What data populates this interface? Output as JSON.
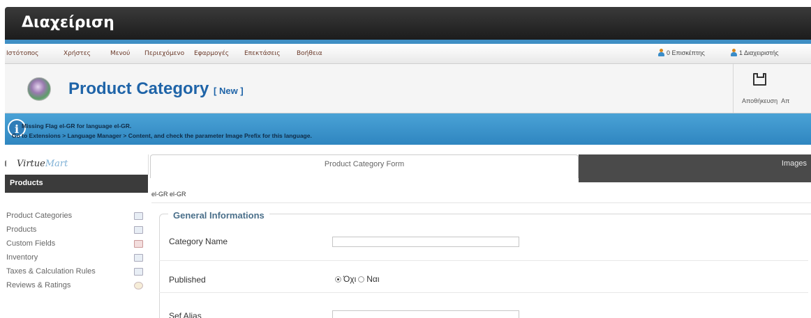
{
  "header": {
    "title": "Διαχείριση"
  },
  "menu": {
    "items": [
      "Ιστότοπος",
      "Χρήστες",
      "Μενού",
      "Περιεχόμενο",
      "Εφαρμογές",
      "Επεκτάσεις",
      "Βοήθεια"
    ]
  },
  "status": {
    "visitors": "0 Επισκέπτης",
    "admins": "1 Διαχειριστής"
  },
  "title": {
    "main": "Product Category",
    "tag": "[ New ]"
  },
  "toolbar": {
    "save_label": "Αποθήκευση",
    "next_label": "Απ"
  },
  "message": {
    "line1": "Missing Flag el-GR for language el-GR.",
    "line2": "Go to Extensions > Language Manager > Content, and check the parameter Image Prefix for this language."
  },
  "sidebar": {
    "logo_a": "Virtue",
    "logo_b": "Mart",
    "section": "Products",
    "items": [
      {
        "label": "Product Categories",
        "icon": "categories-icon"
      },
      {
        "label": "Products",
        "icon": "products-icon"
      },
      {
        "label": "Custom Fields",
        "icon": "custom-fields-icon"
      },
      {
        "label": "Inventory",
        "icon": "inventory-icon"
      },
      {
        "label": "Taxes & Calculation Rules",
        "icon": "taxes-icon"
      },
      {
        "label": "Reviews & Ratings",
        "icon": "reviews-icon"
      }
    ]
  },
  "tabs": {
    "form": "Product Category Form",
    "images": "Images"
  },
  "language_label": "el-GR el-GR",
  "form": {
    "legend": "General Informations",
    "category_name_label": "Category Name",
    "category_name_value": "",
    "published_label": "Published",
    "published_options": [
      "Όχι",
      "Ναι"
    ],
    "published_selected": "Όχι",
    "sef_alias_label": "Sef Alias",
    "sef_alias_value": ""
  },
  "colors": {
    "header_bg": "#2a2a2a",
    "accent_blue": "#3f8fc4",
    "title_blue": "#1f64a8",
    "message_bg": "#3b93cb"
  }
}
